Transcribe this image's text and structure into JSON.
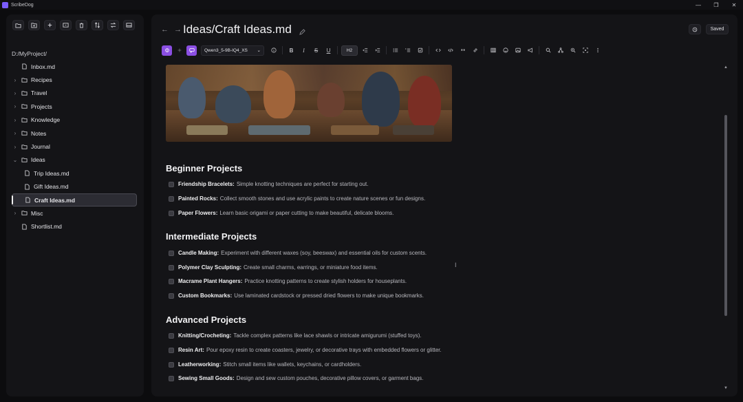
{
  "app": {
    "title": "ScribeDog"
  },
  "window": {
    "minimize": "—",
    "maximize": "❐",
    "close": "✕"
  },
  "sidebar": {
    "project_path": "D:/MyProject/",
    "items": [
      {
        "label": "Inbox.md",
        "type": "file"
      },
      {
        "label": "Recipes",
        "type": "folder"
      },
      {
        "label": "Travel",
        "type": "folder"
      },
      {
        "label": "Projects",
        "type": "folder"
      },
      {
        "label": "Knowledge",
        "type": "folder"
      },
      {
        "label": "Notes",
        "type": "folder"
      },
      {
        "label": "Journal",
        "type": "folder"
      },
      {
        "label": "Ideas",
        "type": "folder-open"
      },
      {
        "label": "Trip Ideas.md",
        "type": "file"
      },
      {
        "label": "Gift Ideas.md",
        "type": "file"
      },
      {
        "label": "Craft Ideas.md",
        "type": "file"
      },
      {
        "label": "Misc",
        "type": "folder"
      },
      {
        "label": "Shortlist.md",
        "type": "file"
      }
    ]
  },
  "header": {
    "title": "Ideas/Craft Ideas.md",
    "saved_label": "Saved"
  },
  "toolbar": {
    "model": "Qwen3_5-9B-IQ4_XS",
    "heading": "H2"
  },
  "document": {
    "sections": [
      {
        "heading": "Beginner Projects",
        "tasks": [
          {
            "bold": "Friendship Bracelets:",
            "text": "Simple knotting techniques are perfect for starting out."
          },
          {
            "bold": "Painted Rocks:",
            "text": "Collect smooth stones and use acrylic paints to create nature scenes or fun designs."
          },
          {
            "bold": "Paper Flowers:",
            "text": "Learn basic origami or paper cutting to make beautiful, delicate blooms."
          }
        ]
      },
      {
        "heading": "Intermediate Projects",
        "tasks": [
          {
            "bold": "Candle Making:",
            "text": "Experiment with different waxes (soy, beeswax) and essential oils for custom scents."
          },
          {
            "bold": "Polymer Clay Sculpting:",
            "text": "Create small charms, earrings, or miniature food items."
          },
          {
            "bold": "Macrame Plant Hangers:",
            "text": "Practice knotting patterns to create stylish holders for houseplants."
          },
          {
            "bold": "Custom Bookmarks:",
            "text": "Use laminated cardstock or pressed dried flowers to make unique bookmarks."
          }
        ]
      },
      {
        "heading": "Advanced Projects",
        "tasks": [
          {
            "bold": "Knitting/Crocheting:",
            "text": "Tackle complex patterns like lace shawls or intricate amigurumi (stuffed toys)."
          },
          {
            "bold": "Resin Art:",
            "text": "Pour epoxy resin to create coasters, jewelry, or decorative trays with embedded flowers or glitter."
          },
          {
            "bold": "Leatherworking:",
            "text": "Stitch small items like wallets, keychains, or cardholders."
          },
          {
            "bold": "Sewing Small Goods:",
            "text": "Design and sew custom pouches, decorative pillow covers, or garment bags."
          }
        ]
      }
    ]
  }
}
